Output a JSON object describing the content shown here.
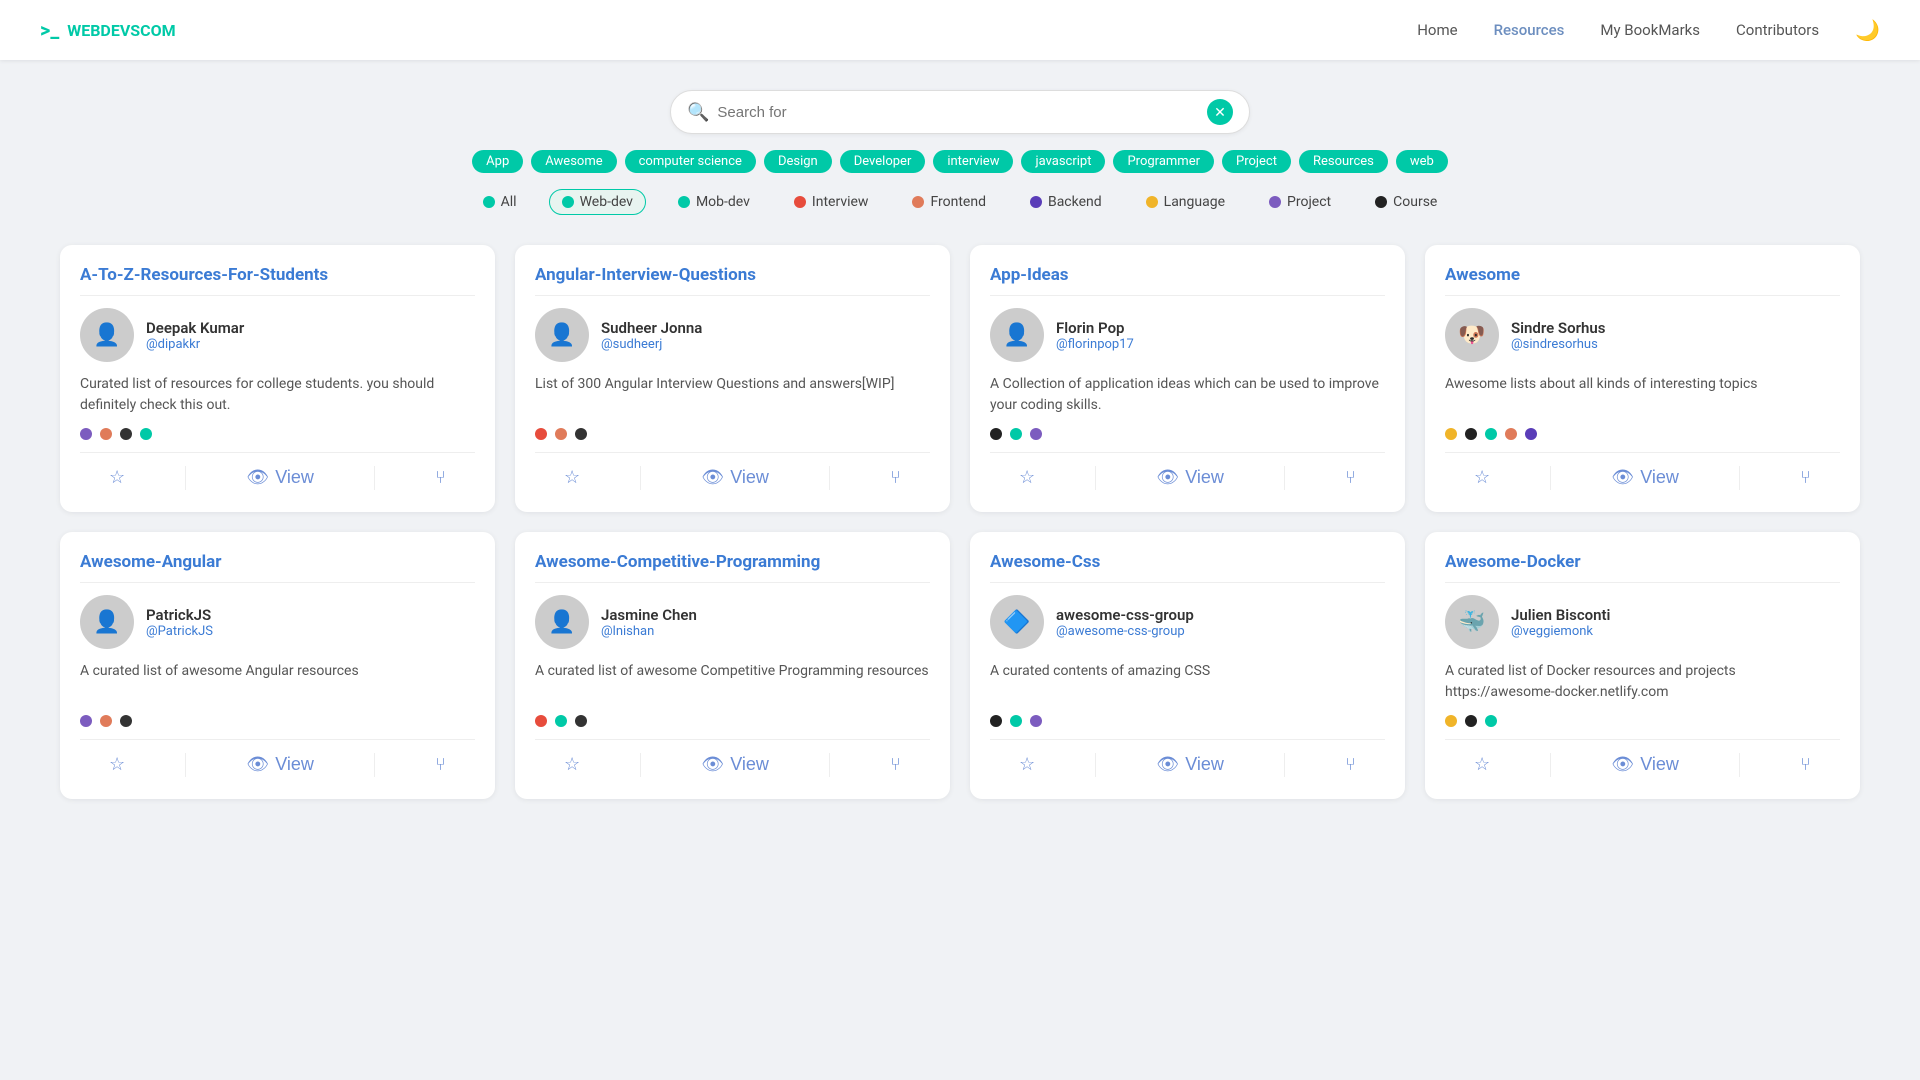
{
  "header": {
    "logo_icon": ">_",
    "logo_text": "WEBDEVSCOM",
    "nav": [
      {
        "label": "Home",
        "active": false
      },
      {
        "label": "Resources",
        "active": true
      },
      {
        "label": "My BookMarks",
        "active": false
      },
      {
        "label": "Contributors",
        "active": false
      }
    ],
    "moon_icon": "🌙"
  },
  "search": {
    "placeholder": "Search for",
    "clear_button": "✕"
  },
  "tags": [
    "App",
    "Awesome",
    "computer science",
    "Design",
    "Developer",
    "interview",
    "javascript",
    "Programmer",
    "Project",
    "Resources",
    "web"
  ],
  "filters": [
    {
      "label": "All",
      "color": "#00c9a7",
      "active": false
    },
    {
      "label": "Web-dev",
      "color": "#00c9a7",
      "active": true
    },
    {
      "label": "Mob-dev",
      "color": "#00c9a7",
      "active": false
    },
    {
      "label": "Interview",
      "color": "#e74c3c",
      "active": false
    },
    {
      "label": "Frontend",
      "color": "#e07b5a",
      "active": false
    },
    {
      "label": "Backend",
      "color": "#5a3db8",
      "active": false
    },
    {
      "label": "Language",
      "color": "#f0b429",
      "active": false
    },
    {
      "label": "Project",
      "color": "#7c5cbf",
      "active": false
    },
    {
      "label": "Course",
      "color": "#222",
      "active": false
    }
  ],
  "cards": [
    {
      "title": "A-To-Z-Resources-For-Students",
      "author_name": "Deepak Kumar",
      "author_handle": "@dipakkr",
      "avatar_emoji": "👤",
      "description": "Curated list of resources for college students. you should definitely check this out.",
      "dots": [
        "#7c5cbf",
        "#e07b5a",
        "#333",
        "#00c9a7"
      ]
    },
    {
      "title": "Angular-Interview-Questions",
      "author_name": "Sudheer Jonna",
      "author_handle": "@sudheerj",
      "avatar_emoji": "👤",
      "description": "List of 300 Angular Interview Questions and answers[WIP]",
      "dots": [
        "#e74c3c",
        "#e07b5a",
        "#333"
      ]
    },
    {
      "title": "App-Ideas",
      "author_name": "Florin Pop",
      "author_handle": "@florinpop17",
      "avatar_emoji": "👤",
      "description": "A Collection of application ideas which can be used to improve your coding skills.",
      "dots": [
        "#222",
        "#00c9a7",
        "#7c5cbf"
      ]
    },
    {
      "title": "Awesome",
      "author_name": "Sindre Sorhus",
      "author_handle": "@sindresorhus",
      "avatar_emoji": "🐶",
      "description": "Awesome lists about all kinds of interesting topics",
      "dots": [
        "#f0b429",
        "#222",
        "#00c9a7",
        "#e07b5a",
        "#5a3db8"
      ]
    },
    {
      "title": "Awesome-Angular",
      "author_name": "PatrickJS",
      "author_handle": "@PatrickJS",
      "avatar_emoji": "👤",
      "description": "A curated list of awesome Angular resources",
      "dots": [
        "#7c5cbf",
        "#e07b5a",
        "#333"
      ]
    },
    {
      "title": "Awesome-Competitive-Programming",
      "author_name": "Jasmine Chen",
      "author_handle": "@lnishan",
      "avatar_emoji": "👤",
      "description": "A curated list of awesome Competitive Programming resources",
      "dots": [
        "#e74c3c",
        "#00c9a7",
        "#333"
      ]
    },
    {
      "title": "Awesome-Css",
      "author_name": "awesome-css-group",
      "author_handle": "@awesome-css-group",
      "avatar_emoji": "🔷",
      "description": "A curated contents of amazing CSS",
      "dots": [
        "#222",
        "#00c9a7",
        "#7c5cbf"
      ]
    },
    {
      "title": "Awesome-Docker",
      "author_name": "Julien Bisconti",
      "author_handle": "@veggiemonk",
      "avatar_emoji": "🐳",
      "description": "A curated list of Docker resources and projects https://awesome-docker.netlify.com",
      "dots": [
        "#f0b429",
        "#222",
        "#00c9a7"
      ]
    }
  ],
  "card_actions": {
    "star": "☆",
    "view_icon": "👁",
    "view_label": "View",
    "fork_icon": "⑂"
  }
}
